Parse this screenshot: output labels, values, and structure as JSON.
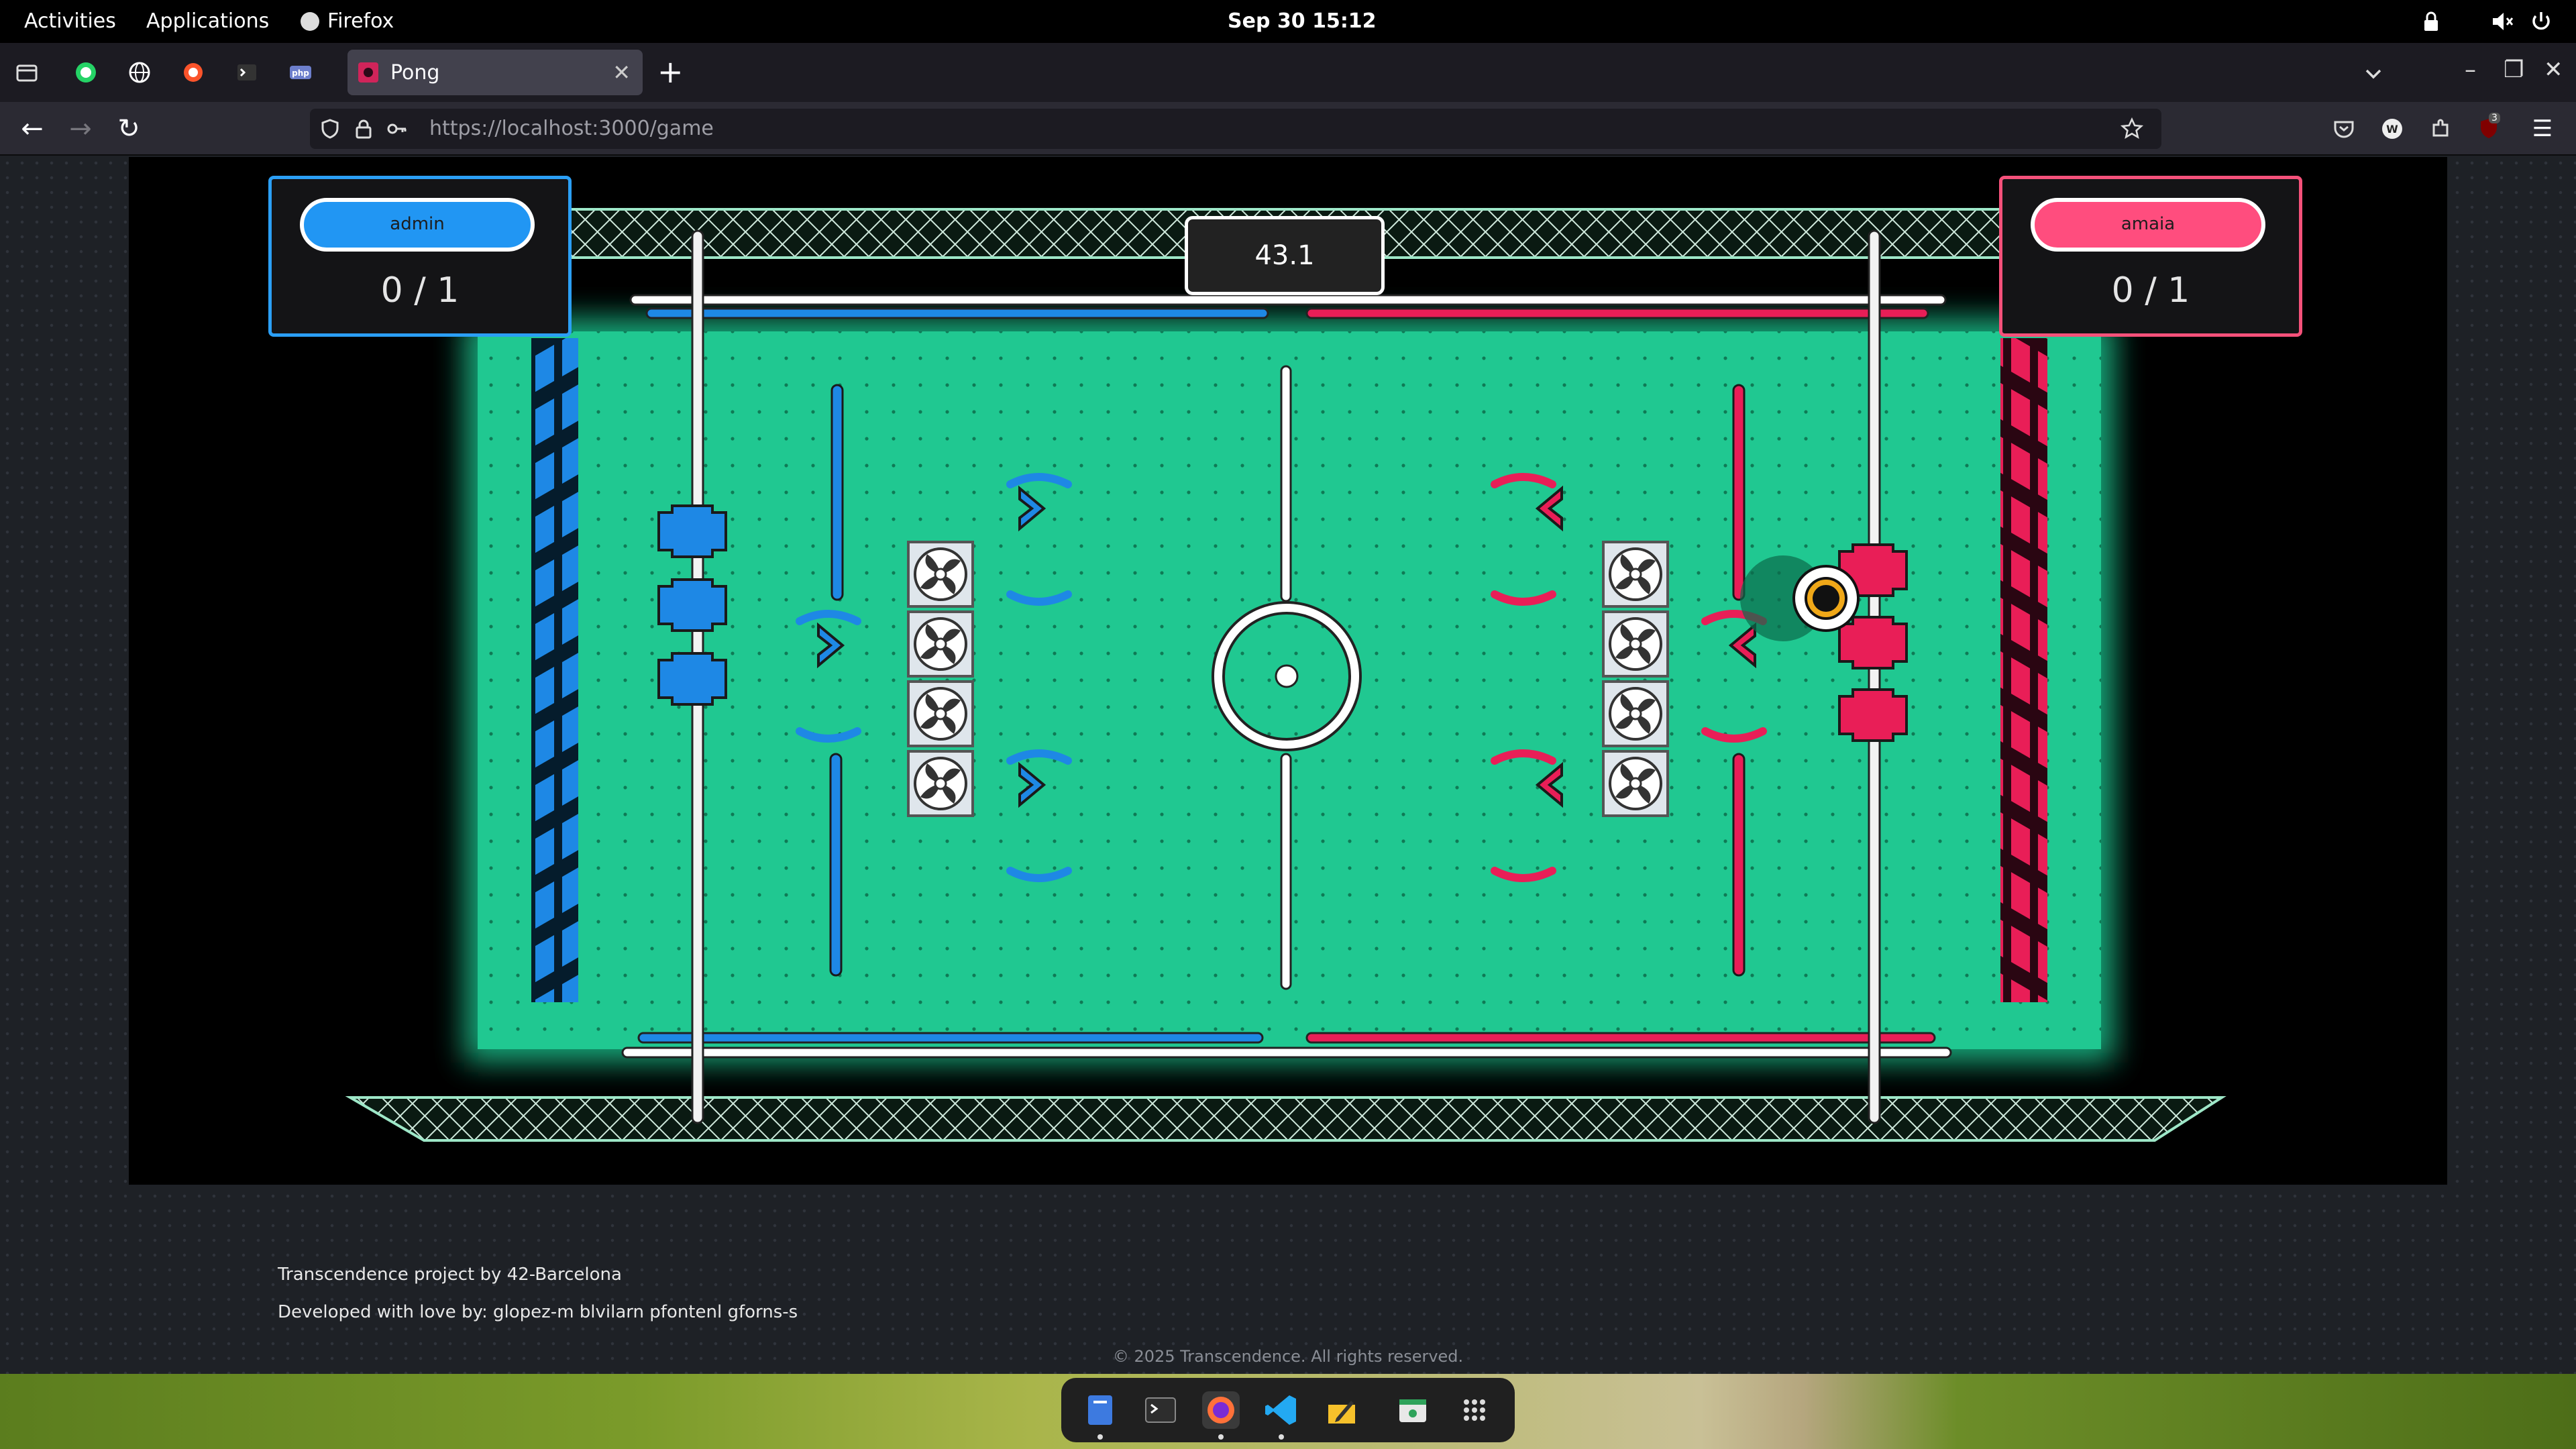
{
  "system": {
    "activities_label": "Activities",
    "applications_label": "Applications",
    "app_name": "Firefox",
    "clock": "Sep 30  15:12"
  },
  "browser": {
    "tab_title": "Pong",
    "url_host": "https://localhost",
    "url_path": ":3000/game",
    "pinned_tabs": [
      "whatsapp-icon",
      "globe-icon",
      "brave-icon",
      "terminal-icon",
      "php-icon"
    ],
    "extension_badge": "3"
  },
  "game": {
    "player_left": {
      "name": "admin",
      "score": "0 / 1",
      "color": "#2196f3"
    },
    "player_right": {
      "name": "amaia",
      "score": "0 / 1",
      "color": "#ff4d7e"
    },
    "timer": "43.1",
    "field_color": "#1fc48f"
  },
  "footer": {
    "project_line": "Transcendence project by 42-Barcelona",
    "developers_line": "Developed with love by: glopez-m blvilarn pfontenl gforns-s",
    "copyright": "© 2025 Transcendence. All rights reserved."
  },
  "dock": {
    "apps": [
      "files-icon",
      "terminal-icon",
      "firefox-icon",
      "vscode-icon",
      "notes-icon",
      "software-store-icon",
      "app-grid-icon"
    ]
  }
}
